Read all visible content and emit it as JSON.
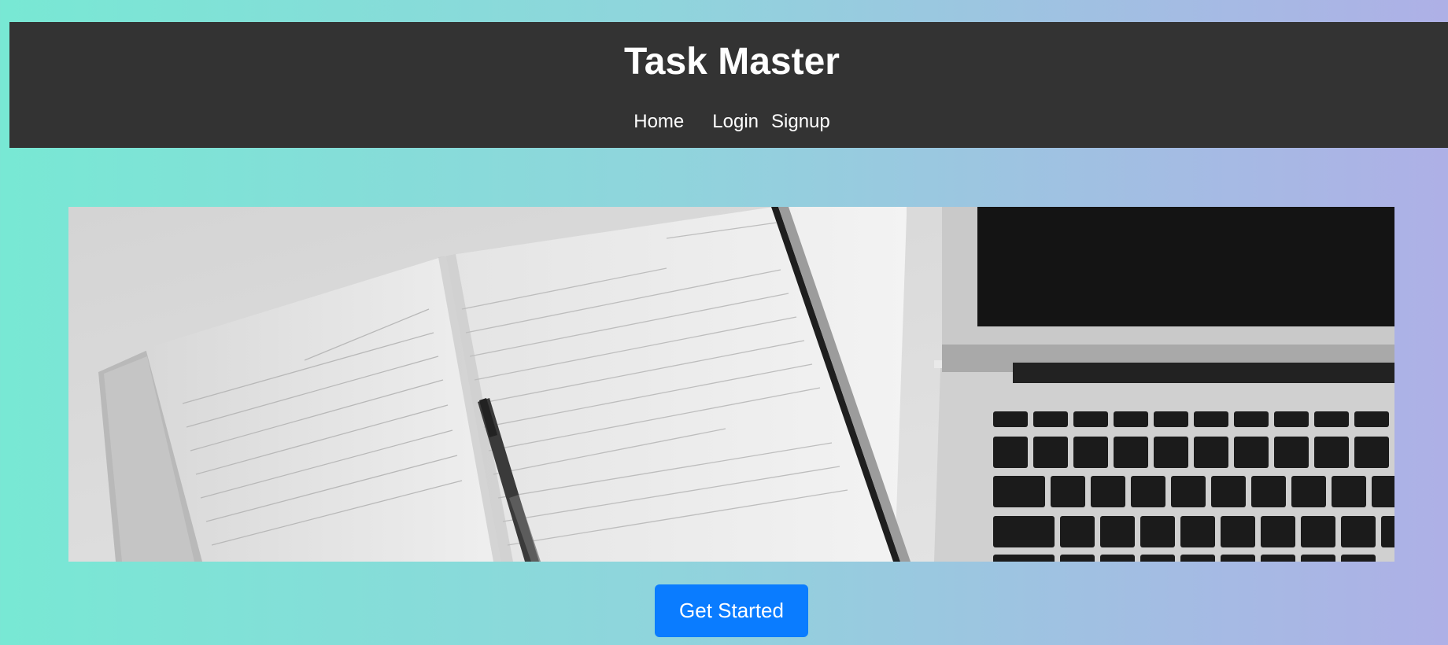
{
  "header": {
    "title": "Task Master",
    "nav": [
      {
        "label": "Home"
      },
      {
        "label": "Login"
      },
      {
        "label": "Signup"
      }
    ]
  },
  "hero": {
    "image": "planner-and-laptop-photo",
    "style": "grayscale"
  },
  "cta": {
    "label": "Get Started",
    "color": "#0a7cff"
  },
  "colors": {
    "header_bg": "#333333",
    "gradient_start": "#78e8d4",
    "gradient_end": "#aeb0e6"
  }
}
